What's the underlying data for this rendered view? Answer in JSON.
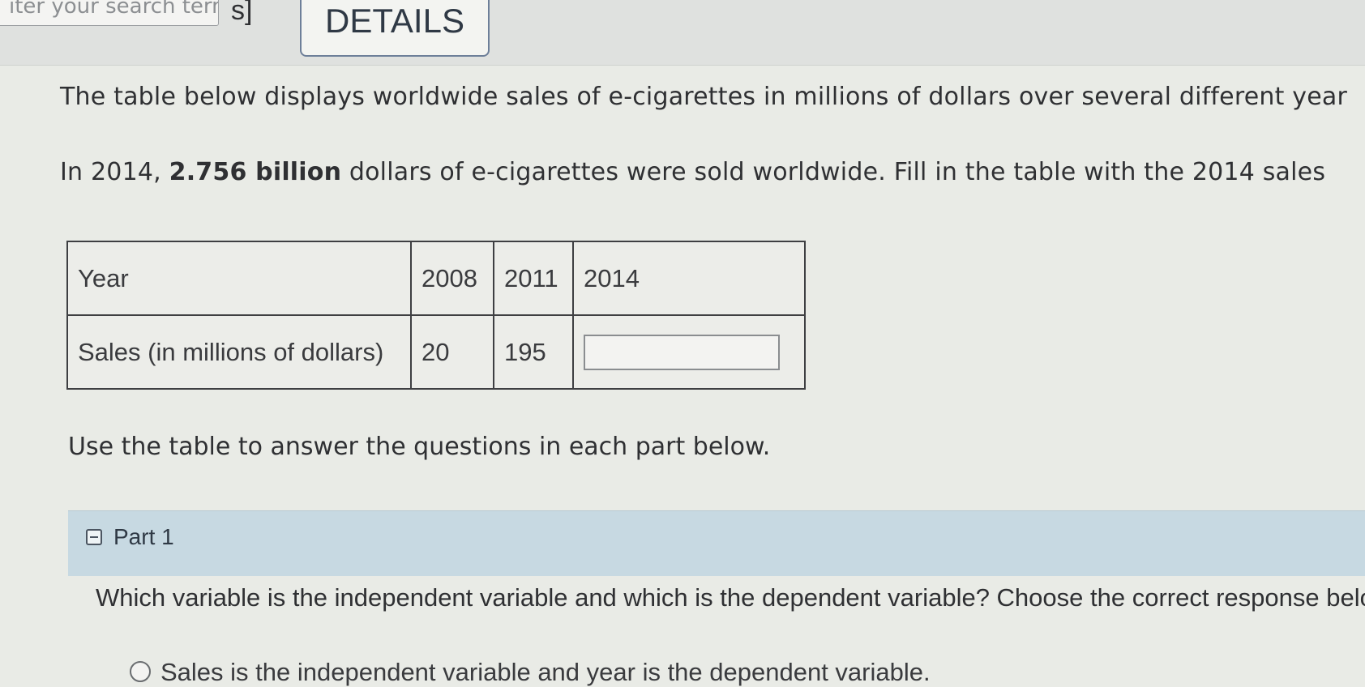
{
  "header": {
    "search_placeholder": "iter your search term",
    "search_suffix": "s]",
    "details_label": "DETAILS"
  },
  "problem": {
    "intro_line": "The table below displays worldwide sales of e-cigarettes in millions of dollars over several different year",
    "fact_prefix": "In 2014, ",
    "fact_bold": "2.756 billion",
    "fact_suffix": " dollars of e-cigarettes were sold worldwide. Fill in the table with the 2014 sales"
  },
  "table": {
    "header_row": [
      "Year",
      "2008",
      "2011",
      "2014"
    ],
    "data_row_label": "Sales (in millions of dollars)",
    "data_values": [
      "20",
      "195"
    ],
    "answer_value": ""
  },
  "instructions": "Use the table to answer the questions in each part below.",
  "part1": {
    "label": "Part 1",
    "question": "Which variable is the independent variable and which is the dependent variable? Choose the correct response below.",
    "option_1": "Sales is the independent variable and year is the dependent variable."
  }
}
